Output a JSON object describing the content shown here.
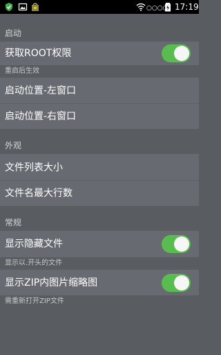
{
  "status_bar": {
    "time": "17:19",
    "signal_dots": "○○○○",
    "left_icons": [
      "shield-app-icon",
      "image-icon",
      "bag-app-icon"
    ],
    "right_icons": [
      "wifi-icon",
      "battery-charging-icon"
    ]
  },
  "sections": {
    "startup": {
      "header": "启动",
      "root_label": "获取ROOT权限",
      "root_hint": "重启后生效",
      "left_window_label": "启动位置-左窗口",
      "right_window_label": "启动位置-右窗口"
    },
    "appearance": {
      "header": "外观",
      "file_list_size_label": "文件列表大小",
      "max_filename_lines_label": "文件名最大行数"
    },
    "general": {
      "header": "常规",
      "show_hidden_label": "显示隐藏文件",
      "show_hidden_hint": "显示以.开头的文件",
      "zip_thumbnail_label": "显示ZIP内图片缩略图",
      "zip_thumbnail_hint": "需重新打开ZIP文件"
    }
  },
  "toggles": {
    "root": true,
    "show_hidden": true,
    "zip_thumbnail": true
  },
  "colors": {
    "accent": "#58bd4e",
    "background": "#595c61",
    "row": "#676a70"
  }
}
